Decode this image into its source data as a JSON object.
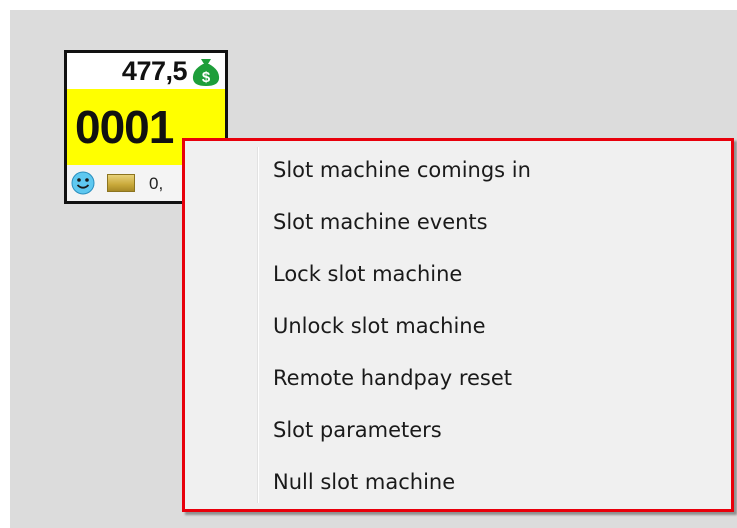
{
  "slot_tile": {
    "amount": "477,5",
    "machine_number": "0001",
    "bottom_value": "0,",
    "money_icon": "money-bag-icon",
    "status_icon": "smiley-icon",
    "coin_icon": "coin-icon",
    "colors": {
      "number_background": "#ffff00",
      "money_bag": "#1e9e3a",
      "smiley": "#5ec8f0"
    }
  },
  "context_menu": {
    "border_color": "#e8000b",
    "items": [
      {
        "label": "Slot machine comings in"
      },
      {
        "label": "Slot machine events"
      },
      {
        "label": "Lock slot machine"
      },
      {
        "label": "Unlock slot machine"
      },
      {
        "label": "Remote handpay reset"
      },
      {
        "label": "Slot parameters"
      },
      {
        "label": "Null slot machine"
      }
    ]
  }
}
